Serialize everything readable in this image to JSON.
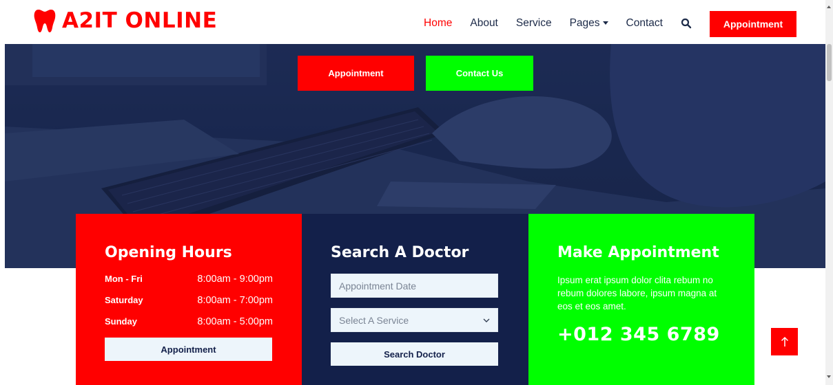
{
  "brand": {
    "name": "A2IT ONLINE",
    "icon": "tooth-icon",
    "color": "#ff0000"
  },
  "nav": {
    "items": [
      {
        "label": "Home",
        "active": true
      },
      {
        "label": "About"
      },
      {
        "label": "Service"
      },
      {
        "label": "Pages",
        "dropdown": true
      },
      {
        "label": "Contact"
      }
    ],
    "search_icon": "search-icon",
    "cta_label": "Appointment"
  },
  "hero": {
    "primary_button": "Appointment",
    "secondary_button": "Contact Us"
  },
  "opening_hours": {
    "title": "Opening Hours",
    "rows": [
      {
        "day": "Mon - Fri",
        "time": "8:00am - 9:00pm"
      },
      {
        "day": "Saturday",
        "time": "8:00am - 7:00pm"
      },
      {
        "day": "Sunday",
        "time": "8:00am - 5:00pm"
      }
    ],
    "button": "Appointment"
  },
  "search_doctor": {
    "title": "Search A Doctor",
    "date_placeholder": "Appointment Date",
    "service_select": "Select A Service",
    "button": "Search Doctor"
  },
  "make_appointment": {
    "title": "Make Appointment",
    "description": "Ipsum erat ipsum dolor clita rebum no rebum dolores labore, ipsum magna at eos et eos amet.",
    "phone": "+012 345 6789"
  },
  "back_to_top": {
    "icon": "arrow-up-icon"
  },
  "colors": {
    "accent_red": "#ff0000",
    "accent_green": "#00ff00",
    "navy": "#13204a",
    "light": "#edf5fb"
  }
}
